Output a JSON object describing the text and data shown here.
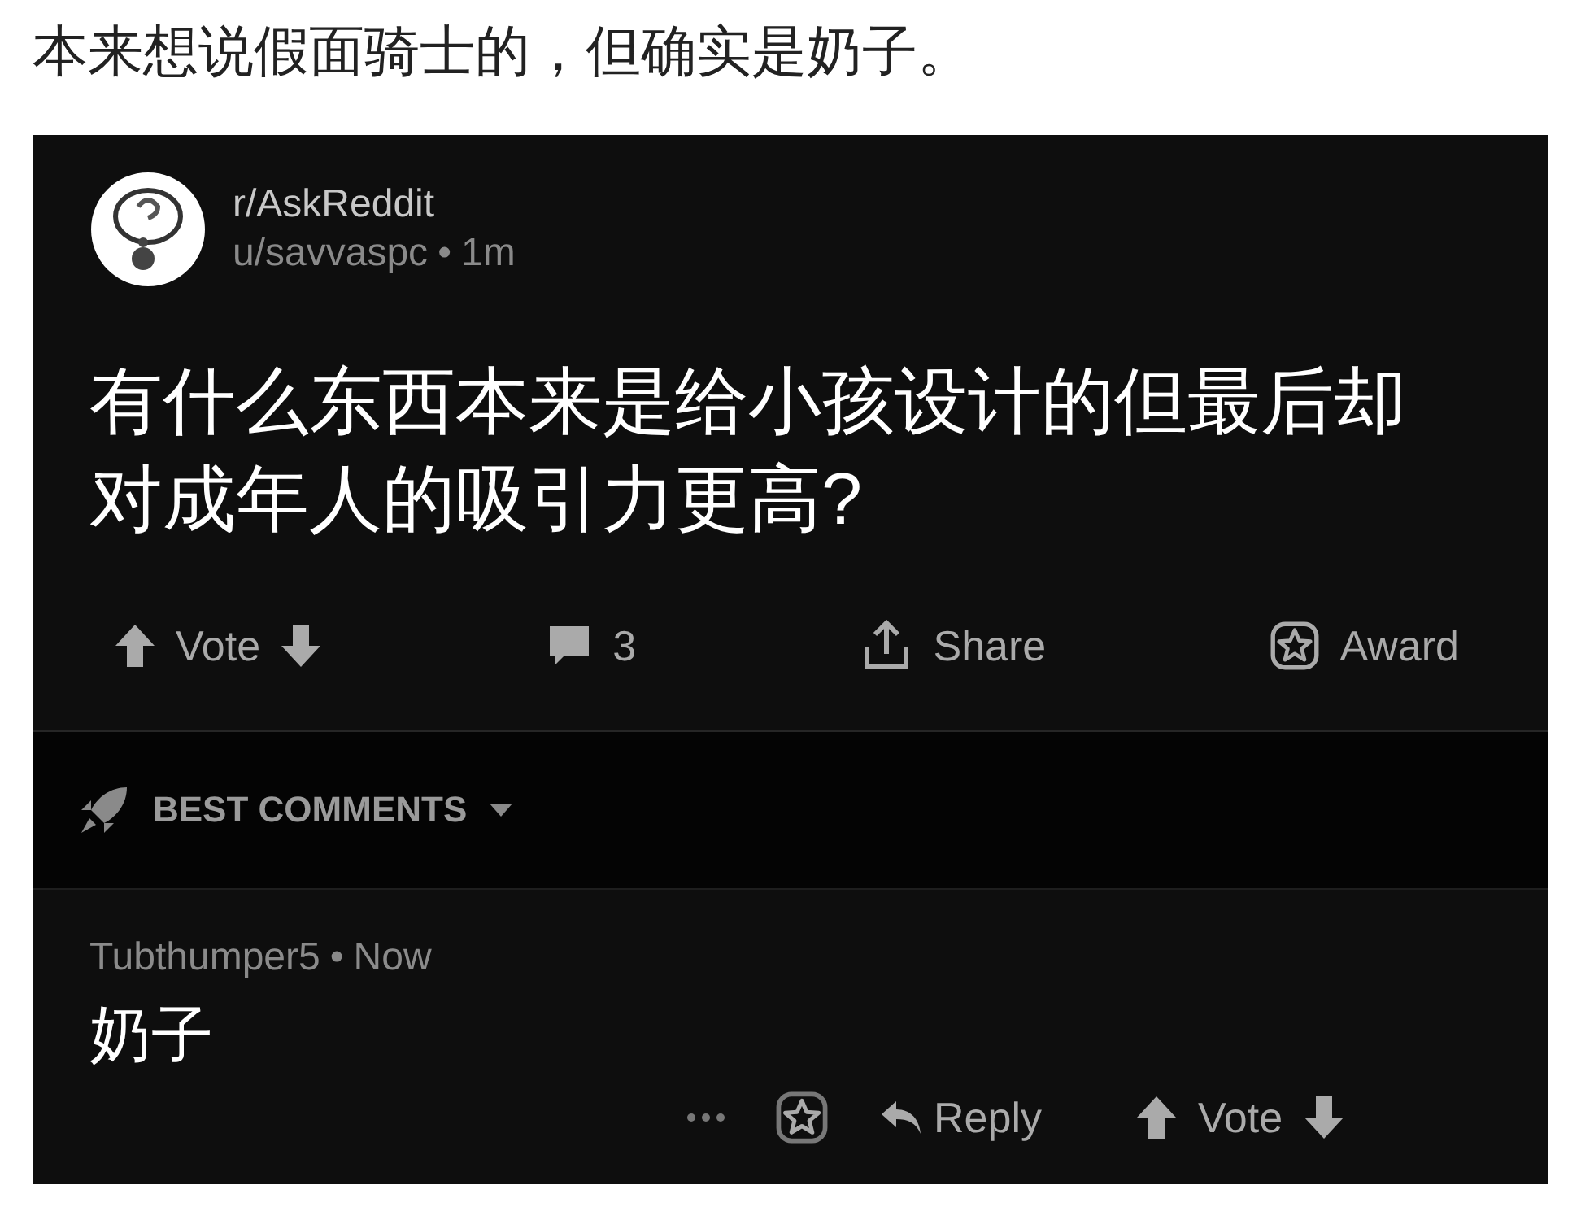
{
  "caption": "本来想说假面骑士的，但确实是奶子。",
  "post": {
    "subreddit": "r/AskReddit",
    "author": "u/savvaspc",
    "separator": "•",
    "time": "1m",
    "title": "有什么东西本来是给小孩设计的但最后却对成年人的吸引力更高?",
    "actions": {
      "vote": "Vote",
      "comments": "3",
      "share": "Share",
      "award": "Award"
    }
  },
  "sort": {
    "label": "BEST COMMENTS"
  },
  "comment": {
    "author": "Tubthumper5",
    "separator": "•",
    "time": "Now",
    "body": "奶子",
    "reply": "Reply",
    "vote": "Vote"
  }
}
